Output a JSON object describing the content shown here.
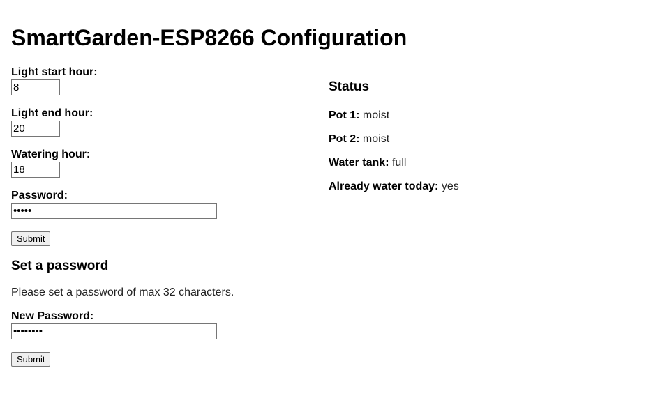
{
  "page": {
    "title": "SmartGarden-ESP8266 Configuration"
  },
  "config_form": {
    "light_start": {
      "label": "Light start hour:",
      "value": "8"
    },
    "light_end": {
      "label": "Light end hour:",
      "value": "20"
    },
    "watering": {
      "label": "Watering hour:",
      "value": "18"
    },
    "password": {
      "label": "Password:",
      "value": "•••••"
    },
    "submit_label": "Submit"
  },
  "set_password": {
    "heading": "Set a password",
    "note": "Please set a password of max 32 characters.",
    "new_password": {
      "label": "New Password:",
      "value": "••••••••"
    },
    "submit_label": "Submit"
  },
  "status": {
    "heading": "Status",
    "items": [
      {
        "label": "Pot 1:",
        "value": "moist"
      },
      {
        "label": "Pot 2:",
        "value": "moist"
      },
      {
        "label": "Water tank:",
        "value": "full"
      },
      {
        "label": "Already water today:",
        "value": "yes"
      }
    ]
  }
}
